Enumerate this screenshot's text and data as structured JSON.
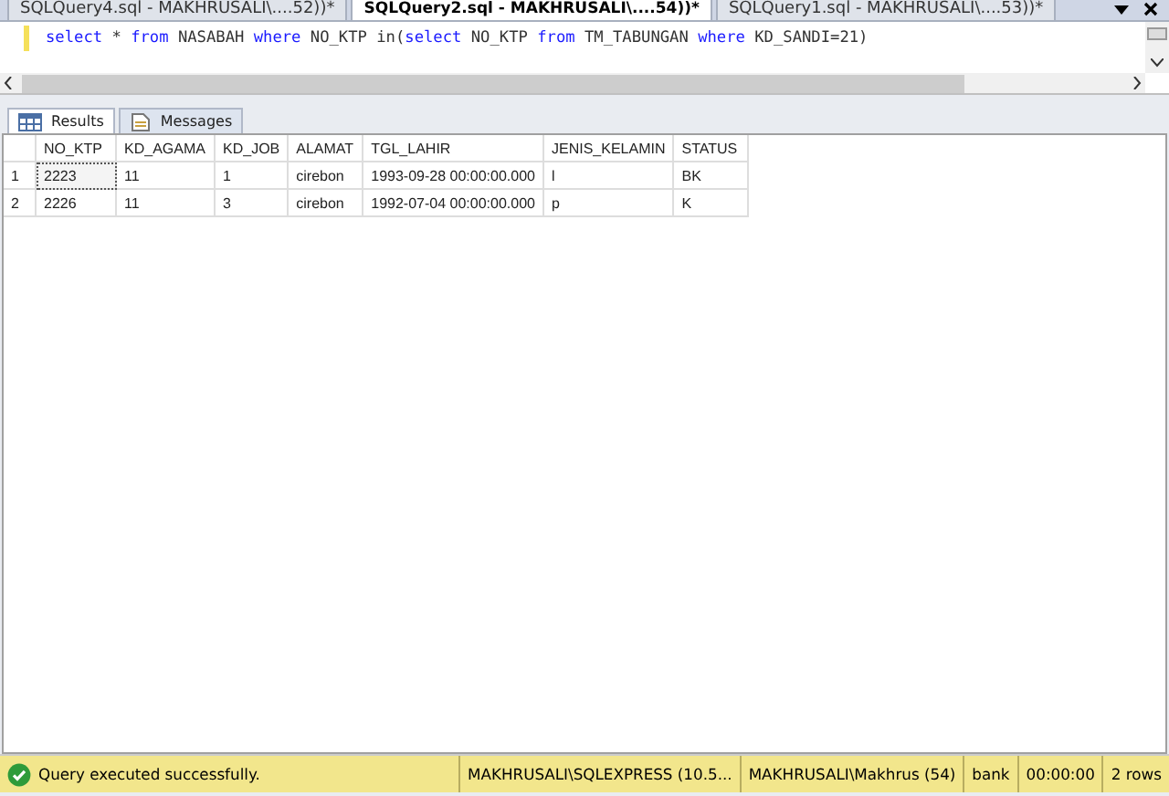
{
  "doc_tabs": [
    {
      "label": "SQLQuery4.sql - MAKHRUSALI\\....52))*",
      "selected": false
    },
    {
      "label": "SQLQuery2.sql - MAKHRUSALI\\....54))*",
      "selected": true
    },
    {
      "label": "SQLQuery1.sql - MAKHRUSALI\\....53))*",
      "selected": false
    }
  ],
  "editor": {
    "tokens": [
      {
        "text": "select",
        "kind": "keyword"
      },
      {
        "text": " * ",
        "kind": "plain"
      },
      {
        "text": "from",
        "kind": "keyword"
      },
      {
        "text": " NASABAH ",
        "kind": "plain"
      },
      {
        "text": "where",
        "kind": "keyword"
      },
      {
        "text": " NO_KTP in(",
        "kind": "plain"
      },
      {
        "text": "select",
        "kind": "keyword"
      },
      {
        "text": " NO_KTP ",
        "kind": "plain"
      },
      {
        "text": "from",
        "kind": "keyword"
      },
      {
        "text": " TM_TABUNGAN ",
        "kind": "plain"
      },
      {
        "text": "where",
        "kind": "keyword"
      },
      {
        "text": " KD_SANDI=21)",
        "kind": "plain"
      }
    ]
  },
  "result_tabs": [
    {
      "label": "Results",
      "selected": true
    },
    {
      "label": "Messages",
      "selected": false
    }
  ],
  "grid": {
    "columns": [
      "NO_KTP",
      "KD_AGAMA",
      "KD_JOB",
      "ALAMAT",
      "TGL_LAHIR",
      "JENIS_KELAMIN",
      "STATUS"
    ],
    "rows": [
      {
        "number": "1",
        "cells": [
          {
            "text": "2223",
            "focused": true
          },
          {
            "text": "11",
            "focused": false
          },
          {
            "text": "1",
            "focused": false
          },
          {
            "text": "cirebon",
            "focused": false
          },
          {
            "text": "1993-09-28 00:00:00.000",
            "focused": false
          },
          {
            "text": "l",
            "focused": false
          },
          {
            "text": "BK",
            "focused": false
          }
        ]
      },
      {
        "number": "2",
        "cells": [
          {
            "text": "2226",
            "focused": false
          },
          {
            "text": "11",
            "focused": false
          },
          {
            "text": "3",
            "focused": false
          },
          {
            "text": "cirebon",
            "focused": false
          },
          {
            "text": "1992-07-04 00:00:00.000",
            "focused": false
          },
          {
            "text": "p",
            "focused": false
          },
          {
            "text": "K",
            "focused": false
          }
        ]
      }
    ]
  },
  "status_bar": {
    "message": "Query executed successfully.",
    "fields": [
      "MAKHRUSALI\\SQLEXPRESS (10.5...",
      "MAKHRUSALI\\Makhrus (54)",
      "bank",
      "00:00:00",
      "2 rows"
    ]
  }
}
